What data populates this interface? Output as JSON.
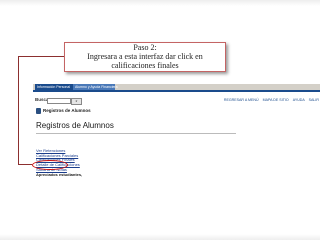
{
  "callout": {
    "title": "Paso 2:",
    "line1": "Ingresara a esta interfaz dar click en",
    "line2": "calificaciones finales"
  },
  "screenshot": {
    "tabs": [
      "Información Personal",
      "Alumno y Ayuda Financiera"
    ],
    "search_label": "Buscar",
    "go_button": "Ir",
    "top_links": [
      "REGRESAR A MENÚ",
      "MAPA DE SITIO",
      "AYUDA",
      "SALIR"
    ],
    "app_title": "Registros de Alumnos",
    "page_title": "Registros de Alumnos",
    "menu_items": [
      {
        "label": "Ver Retenciones"
      },
      {
        "label": "Calificaciones Parciales"
      },
      {
        "label": "Calificaciones Finales"
      },
      {
        "label": "Detalle de Calificaciones"
      },
      {
        "label": "Sábana de Notas"
      },
      {
        "label": "Apreciados estudiantes,"
      }
    ]
  },
  "colors": {
    "accent_dark": "#8c2f2f",
    "highlight": "#cc1111",
    "tab_active": "#1a4b8c",
    "tab_inactive": "#4a79b8",
    "link": "#1a3d8c"
  }
}
